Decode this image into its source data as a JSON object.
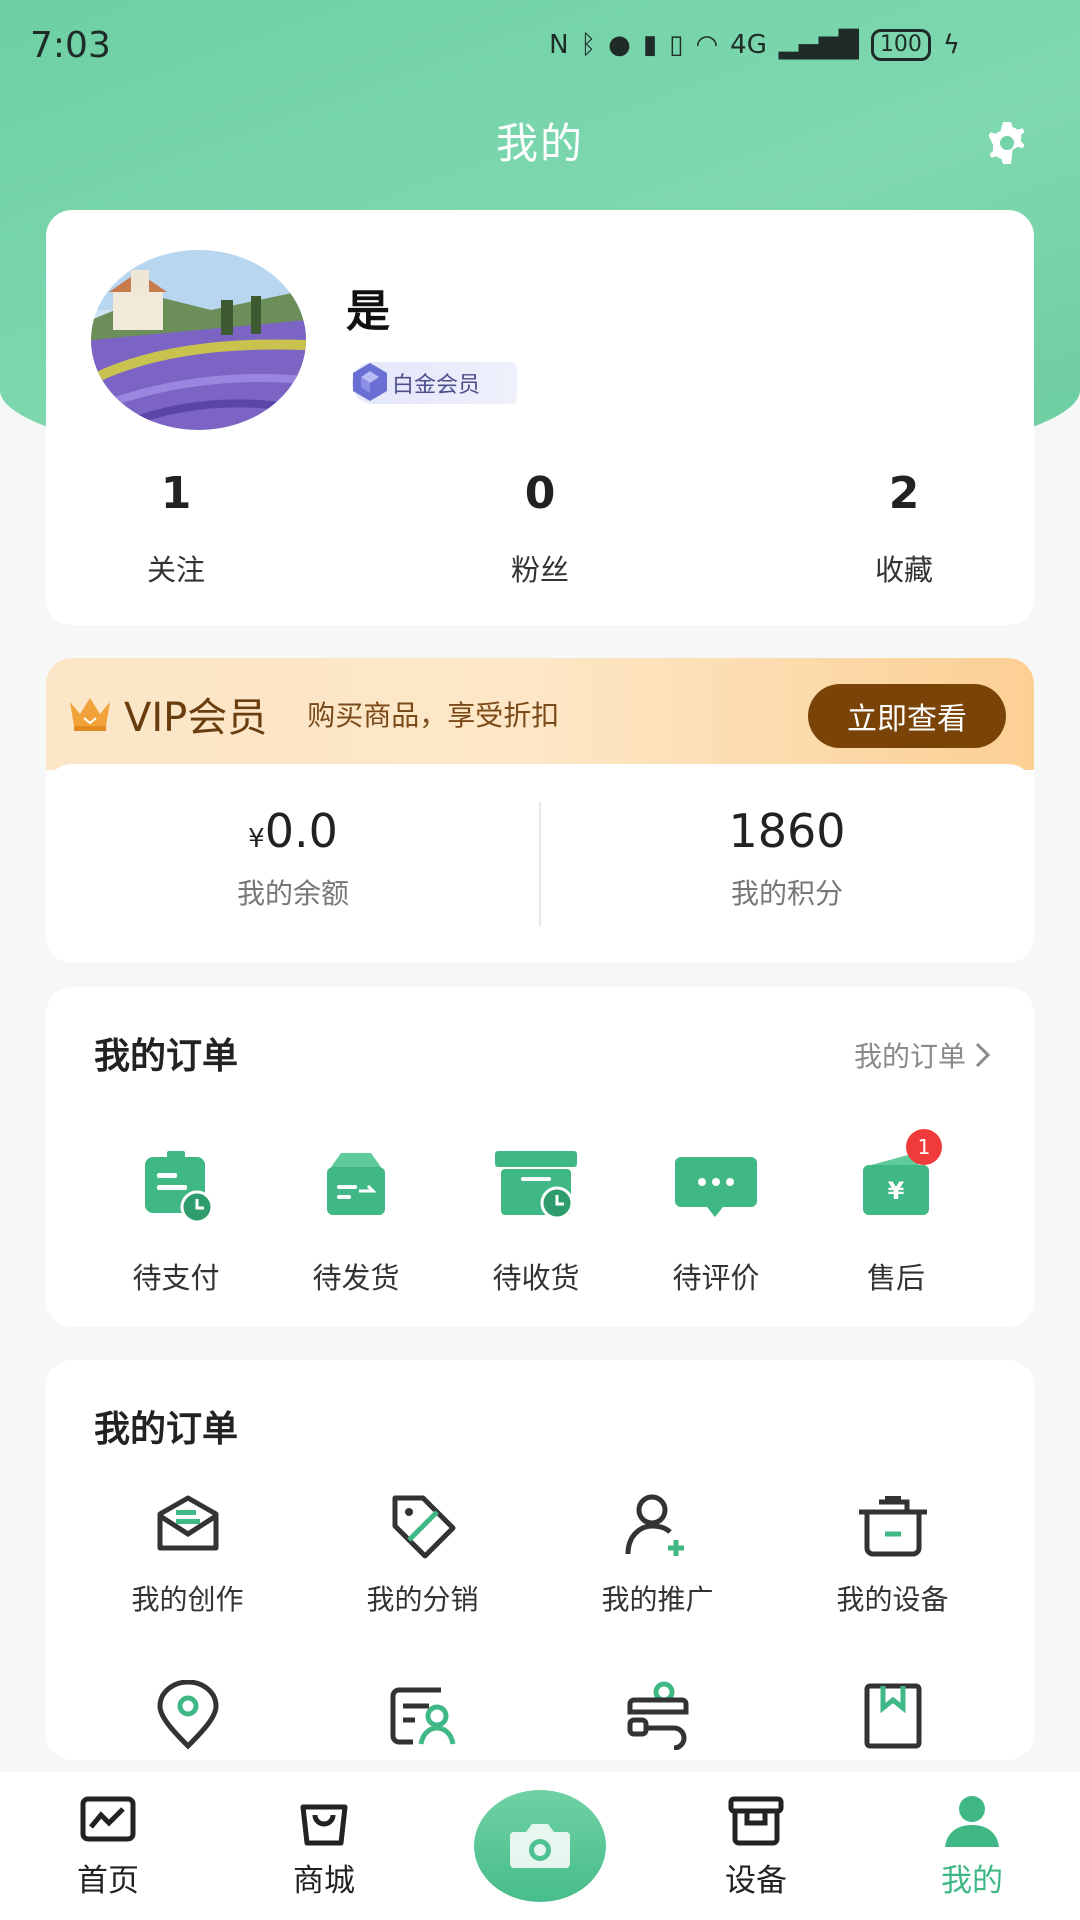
{
  "status_bar": {
    "time": "7:03",
    "network": "4G",
    "battery": "100"
  },
  "header": {
    "title": "我的"
  },
  "profile": {
    "username": "是",
    "member_level": "白金会员",
    "stats": [
      {
        "value": "1",
        "label": "关注"
      },
      {
        "value": "0",
        "label": "粉丝"
      },
      {
        "value": "2",
        "label": "收藏"
      }
    ]
  },
  "vip": {
    "title": "VIP会员",
    "subtitle": "购买商品，享受折扣",
    "button": "立即查看",
    "balance": {
      "currency": "¥",
      "value": "0.0",
      "label": "我的余额"
    },
    "points": {
      "value": "1860",
      "label": "我的积分"
    }
  },
  "orders": {
    "title": "我的订单",
    "more_label": "我的订单",
    "items": [
      {
        "label": "待支付",
        "icon": "pending-payment-icon"
      },
      {
        "label": "待发货",
        "icon": "pending-shipment-icon"
      },
      {
        "label": "待收货",
        "icon": "pending-receipt-icon"
      },
      {
        "label": "待评价",
        "icon": "pending-review-icon"
      },
      {
        "label": "售后",
        "icon": "after-sales-icon",
        "badge": "1"
      }
    ]
  },
  "tools": {
    "title": "我的订单",
    "items": [
      {
        "label": "我的创作",
        "icon": "creation-mail-icon"
      },
      {
        "label": "我的分销",
        "icon": "distribution-tag-icon"
      },
      {
        "label": "我的推广",
        "icon": "promotion-user-icon"
      },
      {
        "label": "我的设备",
        "icon": "device-pot-icon"
      },
      {
        "label": "",
        "icon": "location-pin-icon"
      },
      {
        "label": "",
        "icon": "profile-card-icon"
      },
      {
        "label": "",
        "icon": "flow-chart-icon"
      },
      {
        "label": "",
        "icon": "bookmark-icon"
      }
    ]
  },
  "tabbar": {
    "items": [
      {
        "label": "首页",
        "icon": "home-chart-icon"
      },
      {
        "label": "商城",
        "icon": "shopping-bag-icon"
      },
      {
        "label": "",
        "icon": "camera-icon"
      },
      {
        "label": "设备",
        "icon": "device-box-icon"
      },
      {
        "label": "我的",
        "icon": "person-icon",
        "active": true
      }
    ]
  },
  "colors": {
    "primary": "#3fb886",
    "header_bg": "#74d3a8",
    "vip_button": "#7a4409",
    "badge": "#f03b3b"
  }
}
